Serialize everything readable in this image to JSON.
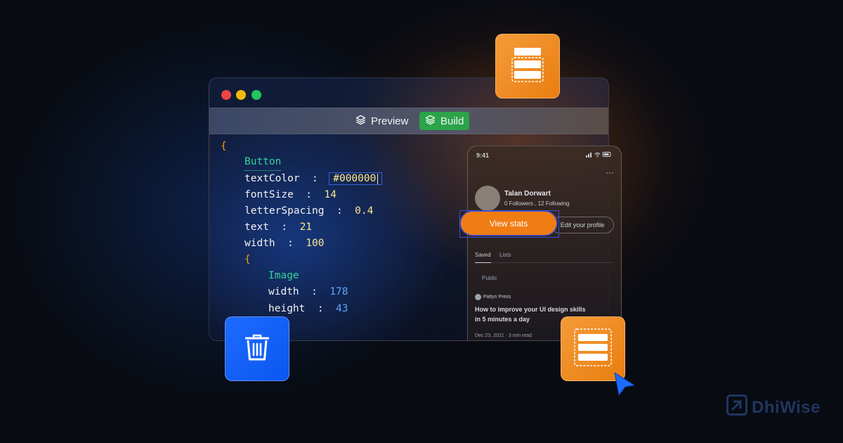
{
  "window": {
    "dots": [
      "#ef4444",
      "#f5b70a",
      "#22c55e"
    ],
    "toolbar": {
      "preview_label": "Preview",
      "build_label": "Build",
      "build_color": "#2ba34a"
    }
  },
  "code": {
    "open_brace": "{",
    "component": "Button",
    "props": [
      {
        "key": "textColor",
        "value": "#000000"
      },
      {
        "key": "fontSize",
        "value": "14"
      },
      {
        "key": "letterSpacing",
        "value": "0.4"
      },
      {
        "key": "text",
        "value": "21"
      },
      {
        "key": "width",
        "value": "100"
      }
    ],
    "inner_brace": "{",
    "child_component": "Image",
    "child_props": [
      {
        "key": "width",
        "value": "178"
      },
      {
        "key": "height",
        "value": "43"
      }
    ]
  },
  "phone": {
    "time": "9:41",
    "menu": "···",
    "name": "Talan Dorwart",
    "stats": "0 Followers  , 12 Following",
    "view_stats": "View stats",
    "edit_profile": "Edit your profile",
    "tabs": [
      "Saved",
      "Lists"
    ],
    "visibility": "Public",
    "publisher": "Paltyn Press",
    "article_title_1": "How to improve your UI design skills",
    "article_title_2": "in 5 minutes a day",
    "article_meta": "Dec 23, 2021  ·  3 min read"
  },
  "brand": {
    "name": "DhiWise"
  },
  "colors": {
    "accent_orange": "#f07d14",
    "accent_blue": "#1e6bff",
    "selection_blue": "#3b4fd6"
  }
}
